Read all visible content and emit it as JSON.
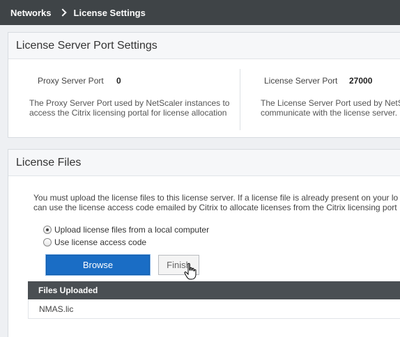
{
  "breadcrumb": {
    "root": "Networks",
    "current": "License Settings"
  },
  "port_settings": {
    "title": "License Server Port Settings",
    "proxy": {
      "label": "Proxy Server Port",
      "value": "0",
      "desc_line1": "The Proxy Server Port used by NetScaler instances to",
      "desc_line2": "access the Citrix licensing portal for license allocation"
    },
    "license": {
      "label": "License Server Port",
      "value": "27000",
      "desc_line1": "The License Server Port used by NetSc",
      "desc_line2": "communicate with the license server."
    }
  },
  "license_files": {
    "title": "License Files",
    "info_line1": "You must upload the license files to this license server. If a license file is already present on your lo",
    "info_line2": "can use the license access code emailed by Citrix to allocate licenses from the Citrix licensing port",
    "option_upload": "Upload license files from a local computer",
    "option_code": "Use license access code",
    "selected_option": "upload",
    "browse_label": "Browse",
    "finish_label": "Finish",
    "table_header": "Files Uploaded",
    "files": [
      "NMAS.lic"
    ]
  }
}
